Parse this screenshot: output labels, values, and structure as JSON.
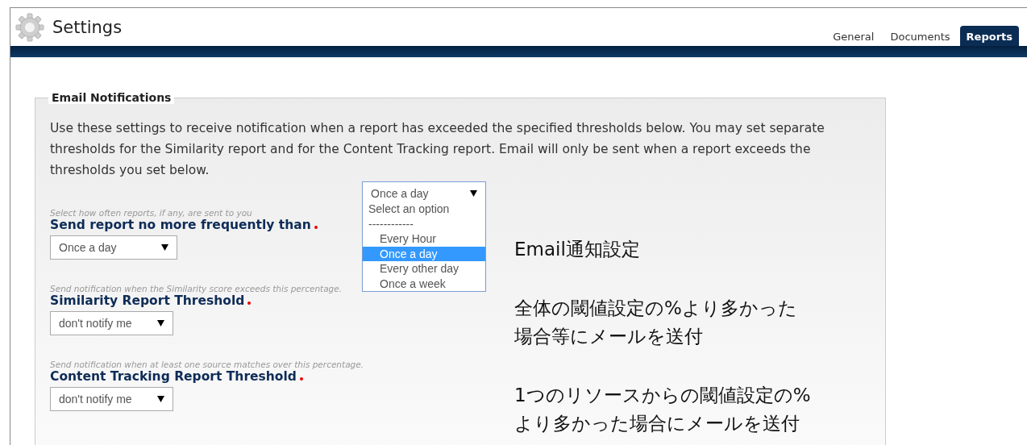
{
  "window": {
    "title": "Settings"
  },
  "tabs": [
    {
      "label": "General",
      "selected": false
    },
    {
      "label": "Documents",
      "selected": false
    },
    {
      "label": "Reports",
      "selected": true
    }
  ],
  "section": {
    "legend": "Email Notifications",
    "description": "Use these settings to receive notification when a report has exceeded the specified thresholds below. You may set separate thresholds for the Similarity report and for the Content Tracking report. Email will only be sent when a report exceeds the thresholds you set below.",
    "open_dropdown": {
      "value": "Once a day",
      "options": [
        {
          "label": "Select an option",
          "kind": "header",
          "selected": false
        },
        {
          "label": "------------",
          "kind": "header",
          "selected": false
        },
        {
          "label": "Every Hour",
          "kind": "option",
          "selected": false
        },
        {
          "label": "Once a day",
          "kind": "option",
          "selected": true
        },
        {
          "label": "Every other day",
          "kind": "option",
          "selected": false
        },
        {
          "label": "Once a week",
          "kind": "option",
          "selected": false
        }
      ]
    },
    "fields": [
      {
        "hint": "Select how often reports, if any, are sent to you",
        "label": "Send report no more frequently than",
        "required": true,
        "value": "Once a day"
      },
      {
        "hint": "Send notification when the Similarity score exceeds this percentage.",
        "label": "Similarity Report Threshold",
        "required": true,
        "value": "don't notify me"
      },
      {
        "hint": "Send notification when at least one source matches over this percentage.",
        "label": "Content Tracking Report Threshold",
        "required": true,
        "value": "don't notify me"
      }
    ]
  },
  "annotations": [
    {
      "lines": [
        "Email通知設定"
      ]
    },
    {
      "lines": [
        "全体の閾値設定の%より多かった",
        "場合等にメールを送付"
      ]
    },
    {
      "lines": [
        "1つのリソースからの閾値設定の%",
        "より多かった場合にメールを送付"
      ]
    }
  ]
}
